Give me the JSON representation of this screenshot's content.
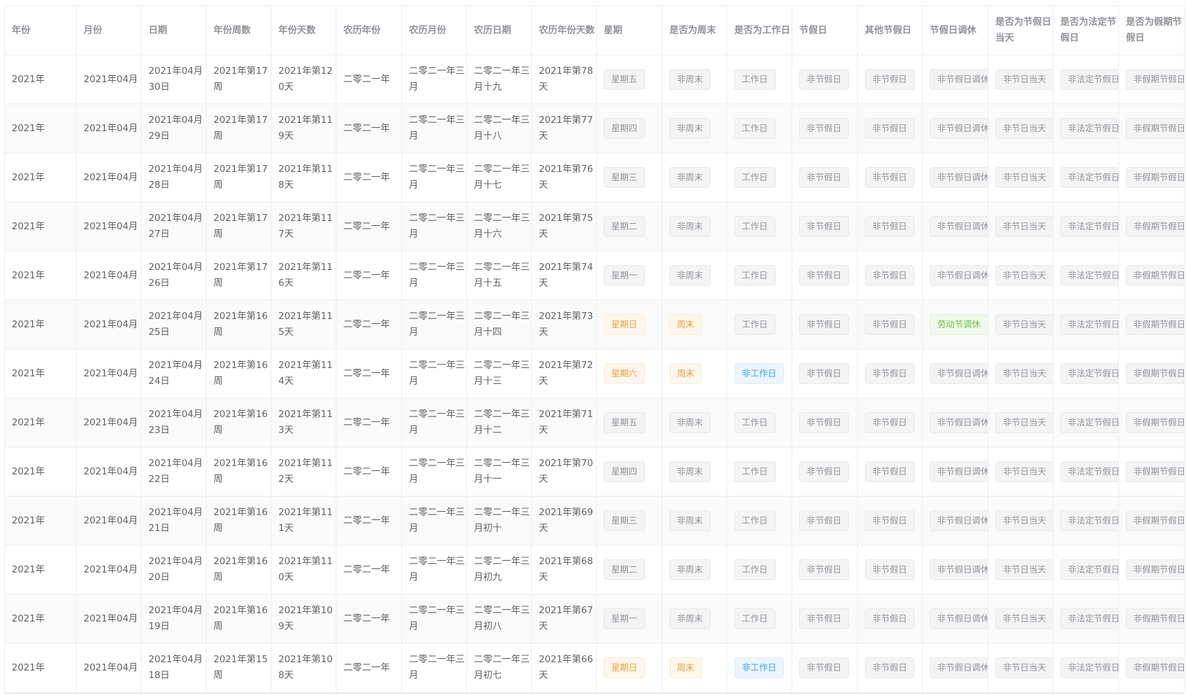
{
  "colors": {
    "tag_info_bg": "#f4f4f5",
    "tag_info_text": "#909399",
    "tag_warning_bg": "#fdf6ec",
    "tag_warning_text": "#e6a23c",
    "tag_primary_bg": "#ecf5ff",
    "tag_primary_text": "#409eff",
    "tag_success_bg": "#f0f9eb",
    "tag_success_text": "#67c23a",
    "header_text": "#909399",
    "border": "#ebeef5"
  },
  "table": {
    "columns": [
      {
        "label": "年份"
      },
      {
        "label": "月份"
      },
      {
        "label": "日期"
      },
      {
        "label": "年份周数"
      },
      {
        "label": "年份天数"
      },
      {
        "label": "农历年份"
      },
      {
        "label": "农历月份"
      },
      {
        "label": "农历日期"
      },
      {
        "label": "农历年份天数"
      },
      {
        "label": "星期"
      },
      {
        "label": "是否为周末"
      },
      {
        "label": "是否为工作日"
      },
      {
        "label": "节假日"
      },
      {
        "label": "其他节假日"
      },
      {
        "label": "节假日调休"
      },
      {
        "label": "是否为节假日当天"
      },
      {
        "label": "是否为法定节假日"
      },
      {
        "label": "是否为假期节假日"
      }
    ],
    "rows": [
      {
        "year": "2021年",
        "month": "2021年04月",
        "date": "2021年04月30日",
        "week_of_year": "2021年第17周",
        "day_of_year": "2021年第120天",
        "lunar_year": "二零二一年",
        "lunar_month": "二零二一年三月",
        "lunar_date": "二零二一年三月十九",
        "lunar_day_of_year": "2021年第78天",
        "weekday": "星期五",
        "is_weekend": "非周末",
        "is_workday": "工作日",
        "holiday": "非节假日",
        "other_holiday": "非节假日",
        "holiday_adjust": "非节假日调休",
        "is_holiday_day": "非节日当天",
        "is_legal_holiday": "非法定节假日",
        "is_vacation_holiday": "非假期节假日"
      },
      {
        "year": "2021年",
        "month": "2021年04月",
        "date": "2021年04月29日",
        "week_of_year": "2021年第17周",
        "day_of_year": "2021年第119天",
        "lunar_year": "二零二一年",
        "lunar_month": "二零二一年三月",
        "lunar_date": "二零二一年三月十八",
        "lunar_day_of_year": "2021年第77天",
        "weekday": "星期四",
        "is_weekend": "非周末",
        "is_workday": "工作日",
        "holiday": "非节假日",
        "other_holiday": "非节假日",
        "holiday_adjust": "非节假日调休",
        "is_holiday_day": "非节日当天",
        "is_legal_holiday": "非法定节假日",
        "is_vacation_holiday": "非假期节假日"
      },
      {
        "year": "2021年",
        "month": "2021年04月",
        "date": "2021年04月28日",
        "week_of_year": "2021年第17周",
        "day_of_year": "2021年第118天",
        "lunar_year": "二零二一年",
        "lunar_month": "二零二一年三月",
        "lunar_date": "二零二一年三月十七",
        "lunar_day_of_year": "2021年第76天",
        "weekday": "星期三",
        "is_weekend": "非周末",
        "is_workday": "工作日",
        "holiday": "非节假日",
        "other_holiday": "非节假日",
        "holiday_adjust": "非节假日调休",
        "is_holiday_day": "非节日当天",
        "is_legal_holiday": "非法定节假日",
        "is_vacation_holiday": "非假期节假日"
      },
      {
        "year": "2021年",
        "month": "2021年04月",
        "date": "2021年04月27日",
        "week_of_year": "2021年第17周",
        "day_of_year": "2021年第117天",
        "lunar_year": "二零二一年",
        "lunar_month": "二零二一年三月",
        "lunar_date": "二零二一年三月十六",
        "lunar_day_of_year": "2021年第75天",
        "weekday": "星期二",
        "is_weekend": "非周末",
        "is_workday": "工作日",
        "holiday": "非节假日",
        "other_holiday": "非节假日",
        "holiday_adjust": "非节假日调休",
        "is_holiday_day": "非节日当天",
        "is_legal_holiday": "非法定节假日",
        "is_vacation_holiday": "非假期节假日"
      },
      {
        "year": "2021年",
        "month": "2021年04月",
        "date": "2021年04月26日",
        "week_of_year": "2021年第17周",
        "day_of_year": "2021年第116天",
        "lunar_year": "二零二一年",
        "lunar_month": "二零二一年三月",
        "lunar_date": "二零二一年三月十五",
        "lunar_day_of_year": "2021年第74天",
        "weekday": "星期一",
        "is_weekend": "非周末",
        "is_workday": "工作日",
        "holiday": "非节假日",
        "other_holiday": "非节假日",
        "holiday_adjust": "非节假日调休",
        "is_holiday_day": "非节日当天",
        "is_legal_holiday": "非法定节假日",
        "is_vacation_holiday": "非假期节假日"
      },
      {
        "year": "2021年",
        "month": "2021年04月",
        "date": "2021年04月25日",
        "week_of_year": "2021年第16周",
        "day_of_year": "2021年第115天",
        "lunar_year": "二零二一年",
        "lunar_month": "二零二一年三月",
        "lunar_date": "二零二一年三月十四",
        "lunar_day_of_year": "2021年第73天",
        "weekday": "星期日",
        "is_weekend": "周末",
        "is_workday": "工作日",
        "holiday": "非节假日",
        "other_holiday": "非节假日",
        "holiday_adjust": "劳动节调休",
        "is_holiday_day": "非节日当天",
        "is_legal_holiday": "非法定节假日",
        "is_vacation_holiday": "非假期节假日",
        "weekday_type": "warning",
        "is_weekend_type": "warning",
        "holiday_adjust_type": "success"
      },
      {
        "year": "2021年",
        "month": "2021年04月",
        "date": "2021年04月24日",
        "week_of_year": "2021年第16周",
        "day_of_year": "2021年第114天",
        "lunar_year": "二零二一年",
        "lunar_month": "二零二一年三月",
        "lunar_date": "二零二一年三月十三",
        "lunar_day_of_year": "2021年第72天",
        "weekday": "星期六",
        "is_weekend": "周末",
        "is_workday": "非工作日",
        "holiday": "非节假日",
        "other_holiday": "非节假日",
        "holiday_adjust": "非节假日调休",
        "is_holiday_day": "非节日当天",
        "is_legal_holiday": "非法定节假日",
        "is_vacation_holiday": "非假期节假日",
        "weekday_type": "warning",
        "is_weekend_type": "warning",
        "is_workday_type": "primary"
      },
      {
        "year": "2021年",
        "month": "2021年04月",
        "date": "2021年04月23日",
        "week_of_year": "2021年第16周",
        "day_of_year": "2021年第113天",
        "lunar_year": "二零二一年",
        "lunar_month": "二零二一年三月",
        "lunar_date": "二零二一年三月十二",
        "lunar_day_of_year": "2021年第71天",
        "weekday": "星期五",
        "is_weekend": "非周末",
        "is_workday": "工作日",
        "holiday": "非节假日",
        "other_holiday": "非节假日",
        "holiday_adjust": "非节假日调休",
        "is_holiday_day": "非节日当天",
        "is_legal_holiday": "非法定节假日",
        "is_vacation_holiday": "非假期节假日"
      },
      {
        "year": "2021年",
        "month": "2021年04月",
        "date": "2021年04月22日",
        "week_of_year": "2021年第16周",
        "day_of_year": "2021年第112天",
        "lunar_year": "二零二一年",
        "lunar_month": "二零二一年三月",
        "lunar_date": "二零二一年三月十一",
        "lunar_day_of_year": "2021年第70天",
        "weekday": "星期四",
        "is_weekend": "非周末",
        "is_workday": "工作日",
        "holiday": "非节假日",
        "other_holiday": "非节假日",
        "holiday_adjust": "非节假日调休",
        "is_holiday_day": "非节日当天",
        "is_legal_holiday": "非法定节假日",
        "is_vacation_holiday": "非假期节假日"
      },
      {
        "year": "2021年",
        "month": "2021年04月",
        "date": "2021年04月21日",
        "week_of_year": "2021年第16周",
        "day_of_year": "2021年第111天",
        "lunar_year": "二零二一年",
        "lunar_month": "二零二一年三月",
        "lunar_date": "二零二一年三月初十",
        "lunar_day_of_year": "2021年第69天",
        "weekday": "星期三",
        "is_weekend": "非周末",
        "is_workday": "工作日",
        "holiday": "非节假日",
        "other_holiday": "非节假日",
        "holiday_adjust": "非节假日调休",
        "is_holiday_day": "非节日当天",
        "is_legal_holiday": "非法定节假日",
        "is_vacation_holiday": "非假期节假日"
      },
      {
        "year": "2021年",
        "month": "2021年04月",
        "date": "2021年04月20日",
        "week_of_year": "2021年第16周",
        "day_of_year": "2021年第110天",
        "lunar_year": "二零二一年",
        "lunar_month": "二零二一年三月",
        "lunar_date": "二零二一年三月初九",
        "lunar_day_of_year": "2021年第68天",
        "weekday": "星期二",
        "is_weekend": "非周末",
        "is_workday": "工作日",
        "holiday": "非节假日",
        "other_holiday": "非节假日",
        "holiday_adjust": "非节假日调休",
        "is_holiday_day": "非节日当天",
        "is_legal_holiday": "非法定节假日",
        "is_vacation_holiday": "非假期节假日"
      },
      {
        "year": "2021年",
        "month": "2021年04月",
        "date": "2021年04月19日",
        "week_of_year": "2021年第16周",
        "day_of_year": "2021年第109天",
        "lunar_year": "二零二一年",
        "lunar_month": "二零二一年三月",
        "lunar_date": "二零二一年三月初八",
        "lunar_day_of_year": "2021年第67天",
        "weekday": "星期一",
        "is_weekend": "非周末",
        "is_workday": "工作日",
        "holiday": "非节假日",
        "other_holiday": "非节假日",
        "holiday_adjust": "非节假日调休",
        "is_holiday_day": "非节日当天",
        "is_legal_holiday": "非法定节假日",
        "is_vacation_holiday": "非假期节假日"
      },
      {
        "year": "2021年",
        "month": "2021年04月",
        "date": "2021年04月18日",
        "week_of_year": "2021年第15周",
        "day_of_year": "2021年第108天",
        "lunar_year": "二零二一年",
        "lunar_month": "二零二一年三月",
        "lunar_date": "二零二一年三月初七",
        "lunar_day_of_year": "2021年第66天",
        "weekday": "星期日",
        "is_weekend": "周末",
        "is_workday": "非工作日",
        "holiday": "非节假日",
        "other_holiday": "非节假日",
        "holiday_adjust": "非节假日调休",
        "is_holiday_day": "非节日当天",
        "is_legal_holiday": "非法定节假日",
        "is_vacation_holiday": "非假期节假日",
        "weekday_type": "warning",
        "is_weekend_type": "warning",
        "is_workday_type": "primary"
      }
    ]
  }
}
